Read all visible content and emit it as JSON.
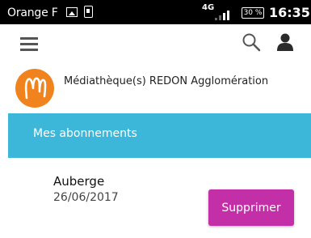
{
  "status_bar": {
    "carrier": "Orange F",
    "network_type": "4G",
    "battery": "30 %",
    "time": "16:35"
  },
  "app_bar": {
    "menu_icon": "hamburger-menu-icon",
    "search_icon": "search-icon",
    "account_icon": "user-icon"
  },
  "library": {
    "name": "Médiathèque(s) REDON Agglomération",
    "logo_color": "#f0831e"
  },
  "section": {
    "title": "Mes abonnements",
    "color": "#3cb6d9"
  },
  "subscription": {
    "name": "Auberge",
    "date": "26/06/2017",
    "delete_label": "Supprimer",
    "delete_color": "#c22fa6"
  }
}
